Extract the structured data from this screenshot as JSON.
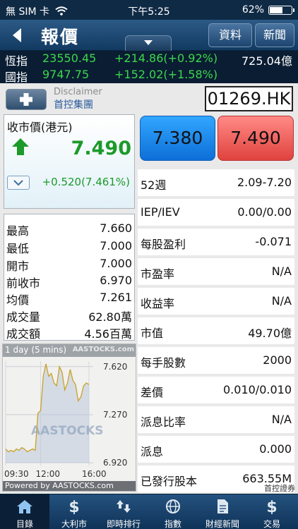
{
  "status_bar": {
    "carrier": "無 SIM 卡",
    "time": "下午5:25",
    "battery": "62%",
    "battery_level": 0.62
  },
  "nav": {
    "title": "報價",
    "buttons": [
      "資料",
      "新聞"
    ]
  },
  "indices": [
    {
      "name": "恆指",
      "value": "23550.45",
      "change": "+214.86(+0.92%)",
      "turnover": "725.04億"
    },
    {
      "name": "國指",
      "value": "9747.75",
      "change": "+152.02(+1.58%)",
      "turnover": ""
    }
  ],
  "stock": {
    "disclaimer": "Disclaimer",
    "name": "首控集團",
    "code": "01269.HK",
    "price_label": "收市價(港元)",
    "price": "7.490",
    "change": "+0.520(7.461%)",
    "bid": "7.380",
    "ask": "7.490"
  },
  "stats": [
    {
      "label": "最高",
      "value": "7.660"
    },
    {
      "label": "最低",
      "value": "7.000"
    },
    {
      "label": "開市",
      "value": "7.000"
    },
    {
      "label": "前收市",
      "value": "6.970"
    },
    {
      "label": "均價",
      "value": "7.261"
    },
    {
      "label": "成交量",
      "value": "62.80萬"
    },
    {
      "label": "成交額",
      "value": "4.56百萬"
    }
  ],
  "info": [
    {
      "label": "52週",
      "value": "2.09-7.20"
    },
    {
      "label": "IEP/IEV",
      "value": "0.00/0.00"
    },
    {
      "label": "每股盈利",
      "value": "-0.071"
    },
    {
      "label": "市盈率",
      "value": "N/A"
    },
    {
      "label": "收益率",
      "value": "N/A"
    },
    {
      "label": "市值",
      "value": "49.70億"
    },
    {
      "label": "每手股數",
      "value": "2000"
    },
    {
      "label": "差價",
      "value": "0.010/0.010"
    },
    {
      "label": "派息比率",
      "value": "N/A"
    },
    {
      "label": "派息",
      "value": "0.000"
    },
    {
      "label": "已發行股本",
      "value": "663.55M"
    }
  ],
  "broker_note": "首控證券",
  "chart_data": {
    "type": "line",
    "title": "1 day (5 mins)",
    "brand": "AASTOCKS.com",
    "watermark": "AASTOCKS",
    "footer": "Powered by AASTOCKS.com",
    "x_labels": [
      "09:30",
      "12:00",
      "16:00"
    ],
    "y_ticks": [
      "7.620",
      "7.270",
      "6.920"
    ],
    "ylim": [
      6.92,
      7.66
    ],
    "grid": true,
    "line_color": "#c9a227",
    "area_color": "#bcc9dc",
    "points": [
      7.02,
      7.0,
      7.01,
      7.0,
      7.02,
      7.01,
      7.03,
      7.02,
      7.0,
      7.01,
      7.02,
      7.01,
      7.28,
      7.3,
      7.55,
      7.64,
      7.55,
      7.57,
      7.5,
      7.48,
      7.62,
      7.58,
      7.45,
      7.5,
      7.6,
      7.52,
      7.49,
      7.37,
      7.4,
      7.48,
      7.5,
      7.49
    ]
  },
  "tabs": [
    {
      "label": "目錄",
      "icon": "home-icon",
      "active": true
    },
    {
      "label": "大利市",
      "icon": "dollar-icon",
      "active": false
    },
    {
      "label": "即時排行",
      "icon": "sort-arrows-icon",
      "active": false
    },
    {
      "label": "指數",
      "icon": "globe-icon",
      "active": false
    },
    {
      "label": "財經新聞",
      "icon": "document-icon",
      "active": false
    },
    {
      "label": "交易",
      "icon": "dollar-trade-icon",
      "active": false
    }
  ],
  "colors": {
    "up": "#1c9a2a",
    "ticker_up": "#3cd84a",
    "nav": "#1a4570",
    "bid": "#1a8ef0",
    "ask": "#f06460"
  }
}
